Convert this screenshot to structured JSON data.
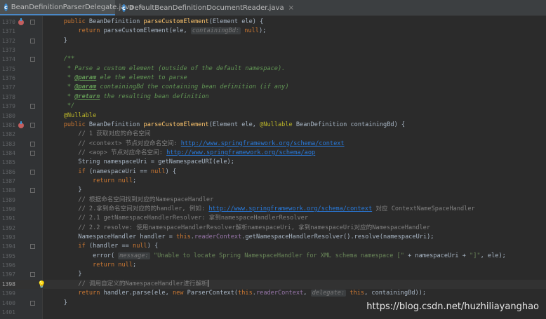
{
  "tabs": [
    {
      "label": "BeanDefinitionParserDelegate.java",
      "active": true
    },
    {
      "label": "DefaultBeanDefinitionDocumentReader.java",
      "active": false
    }
  ],
  "lines": [
    {
      "n": "1370",
      "html": "\t<span class='kw'>public</span> BeanDefinition <span class='fn'>parseCustomElement</span>(Element ele) {"
    },
    {
      "n": "1371",
      "html": "\t\t<span class='kw'>return</span> parseCustomElement(ele, <span class='hint'>containingBd:</span> <span class='kw'>null</span>);"
    },
    {
      "n": "1372",
      "html": "\t}"
    },
    {
      "n": "1373",
      "html": ""
    },
    {
      "n": "1374",
      "html": "\t<span class='doc'>/**</span>"
    },
    {
      "n": "1375",
      "html": "\t<span class='doc'> * Parse a custom element (outside of the default namespace).</span>"
    },
    {
      "n": "1376",
      "html": "\t<span class='doc'> * <span class='tag'>@param</span> ele the element to parse</span>"
    },
    {
      "n": "1377",
      "html": "\t<span class='doc'> * <span class='tag'>@param</span> containingBd the containing bean definition (if any)</span>"
    },
    {
      "n": "1378",
      "html": "\t<span class='doc'> * <span class='tag'>@return</span> the resulting bean definition</span>"
    },
    {
      "n": "1379",
      "html": "\t<span class='doc'> */</span>"
    },
    {
      "n": "1380",
      "html": "\t<span class='ann'>@Nullable</span>"
    },
    {
      "n": "1381",
      "html": "\t<span class='kw'>public</span> BeanDefinition <span class='fn'>parseCustomElement</span>(Element ele, <span class='ann'>@Nullable</span> BeanDefinition containingBd) {"
    },
    {
      "n": "1382",
      "html": "\t\t<span class='cm'>// 1 获取对应的命名空间</span>"
    },
    {
      "n": "1383",
      "html": "\t\t<span class='cm'>// &lt;context&gt; 节点对应命名空间: <span class='url'>http://www.springframework.org/schema/context</span></span>"
    },
    {
      "n": "1384",
      "html": "\t\t<span class='cm'>// &lt;aop&gt; 节点对应命名空间: <span class='url'>http://www.springframework.org/schema/aop</span></span>"
    },
    {
      "n": "1385",
      "html": "\t\tString namespaceUri = getNamespaceURI(ele);"
    },
    {
      "n": "1386",
      "html": "\t\t<span class='kw'>if</span> (namespaceUri == <span class='kw'>null</span>) {"
    },
    {
      "n": "1387",
      "html": "\t\t\t<span class='kw'>return null</span>;"
    },
    {
      "n": "1388",
      "html": "\t\t}"
    },
    {
      "n": "1389",
      "html": "\t\t<span class='cm'>// 根据命名空间找到对应的NamespaceHandler</span>"
    },
    {
      "n": "1390",
      "html": "\t\t<span class='cm'>// 2.拿到命名空间对应的的handler, 例如: <span class='url'>http://www.springframework.org/schema/context</span> 对应 ContextNameSpaceHandler</span>"
    },
    {
      "n": "1391",
      "html": "\t\t<span class='cm'>// 2.1 getNamespaceHandlerResolver: 拿到namespaceHandlerResolver</span>"
    },
    {
      "n": "1392",
      "html": "\t\t<span class='cm'>// 2.2 resolve: 使用namespaceHandlerResolver解析namespaceUri, 拿到namespaceUri对应的NamespaceHandler</span>"
    },
    {
      "n": "1393",
      "html": "\t\tNamespaceHandler handler = <span class='kw'>this</span>.<span class='fld'>readerContext</span>.getNamespaceHandlerResolver().resolve(namespaceUri);"
    },
    {
      "n": "1394",
      "html": "\t\t<span class='kw'>if</span> (handler == <span class='kw'>null</span>) {"
    },
    {
      "n": "1395",
      "html": "\t\t\terror( <span class='hint'>message:</span> <span class='str'>\"Unable to locate Spring NamespaceHandler for XML schema namespace [\"</span> + namespaceUri + <span class='str'>\"]\"</span>, ele);"
    },
    {
      "n": "1396",
      "html": "\t\t\t<span class='kw'>return null</span>;"
    },
    {
      "n": "1397",
      "html": "\t\t}"
    },
    {
      "n": "1398",
      "html": "\t\t<span class='cm'>// 调用自定义的NamespaceHandler进行解析</span><span class='caret'></span>",
      "current": true
    },
    {
      "n": "1399",
      "html": "\t\t<span class='kw'>return</span> handler.parse(ele, <span class='kw'>new</span> ParserContext(<span class='kw'>this</span>.<span class='fld'>readerContext</span>, <span class='hint'>delegate:</span> <span class='kw'>this</span>, containingBd));"
    },
    {
      "n": "1400",
      "html": "\t}"
    },
    {
      "n": "1401",
      "html": ""
    }
  ],
  "markers": {
    "1370": "override",
    "1381": "override"
  },
  "folds": [
    "1370",
    "1372",
    "1374",
    "1379",
    "1381",
    "1383",
    "1384",
    "1386",
    "1388",
    "1394",
    "1397",
    "1400"
  ],
  "bulb_line": "1398",
  "watermark": "https://blog.csdn.net/huzhiliayanghao",
  "colors": {
    "keyword": "#cc7832",
    "method": "#ffc66d",
    "comment": "#808080",
    "doc": "#629755",
    "string": "#6a8759",
    "url": "#287bde"
  }
}
